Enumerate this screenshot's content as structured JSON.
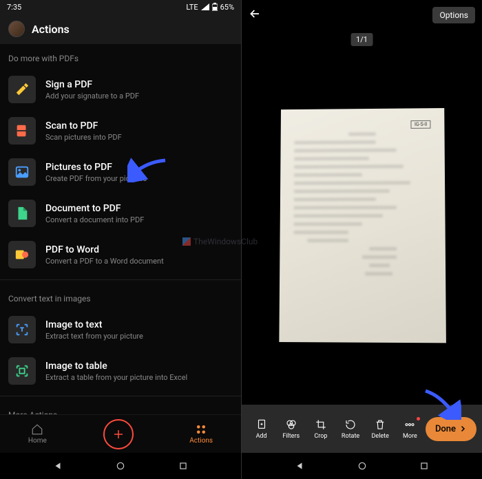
{
  "status": {
    "time": "7:35",
    "network": "LTE",
    "battery": "65%"
  },
  "header": {
    "title": "Actions"
  },
  "sections": {
    "pdfs_label": "Do more with PDFs",
    "text_label": "Convert text in images",
    "more_label": "More Actions"
  },
  "actions": {
    "sign": {
      "title": "Sign a PDF",
      "subtitle": "Add your signature to a PDF"
    },
    "scan": {
      "title": "Scan to PDF",
      "subtitle": "Scan pictures into PDF"
    },
    "pictures": {
      "title": "Pictures to PDF",
      "subtitle": "Create PDF from your pictures"
    },
    "doc": {
      "title": "Document to PDF",
      "subtitle": "Convert a document into PDF"
    },
    "pdfword": {
      "title": "PDF to Word",
      "subtitle": "Convert a PDF to a Word document"
    },
    "imgtext": {
      "title": "Image to text",
      "subtitle": "Extract text from your picture"
    },
    "imgtable": {
      "title": "Image to table",
      "subtitle": "Extract a table from your picture into Excel"
    }
  },
  "nav": {
    "home": "Home",
    "actions": "Actions"
  },
  "scan": {
    "options": "Options",
    "page": "1/1",
    "doc_tag": "IG-S-II",
    "tools": {
      "add": "Add",
      "filters": "Filters",
      "crop": "Crop",
      "rotate": "Rotate",
      "delete": "Delete",
      "more": "More",
      "done": "Done"
    }
  },
  "watermark": "TheWindowsClub"
}
